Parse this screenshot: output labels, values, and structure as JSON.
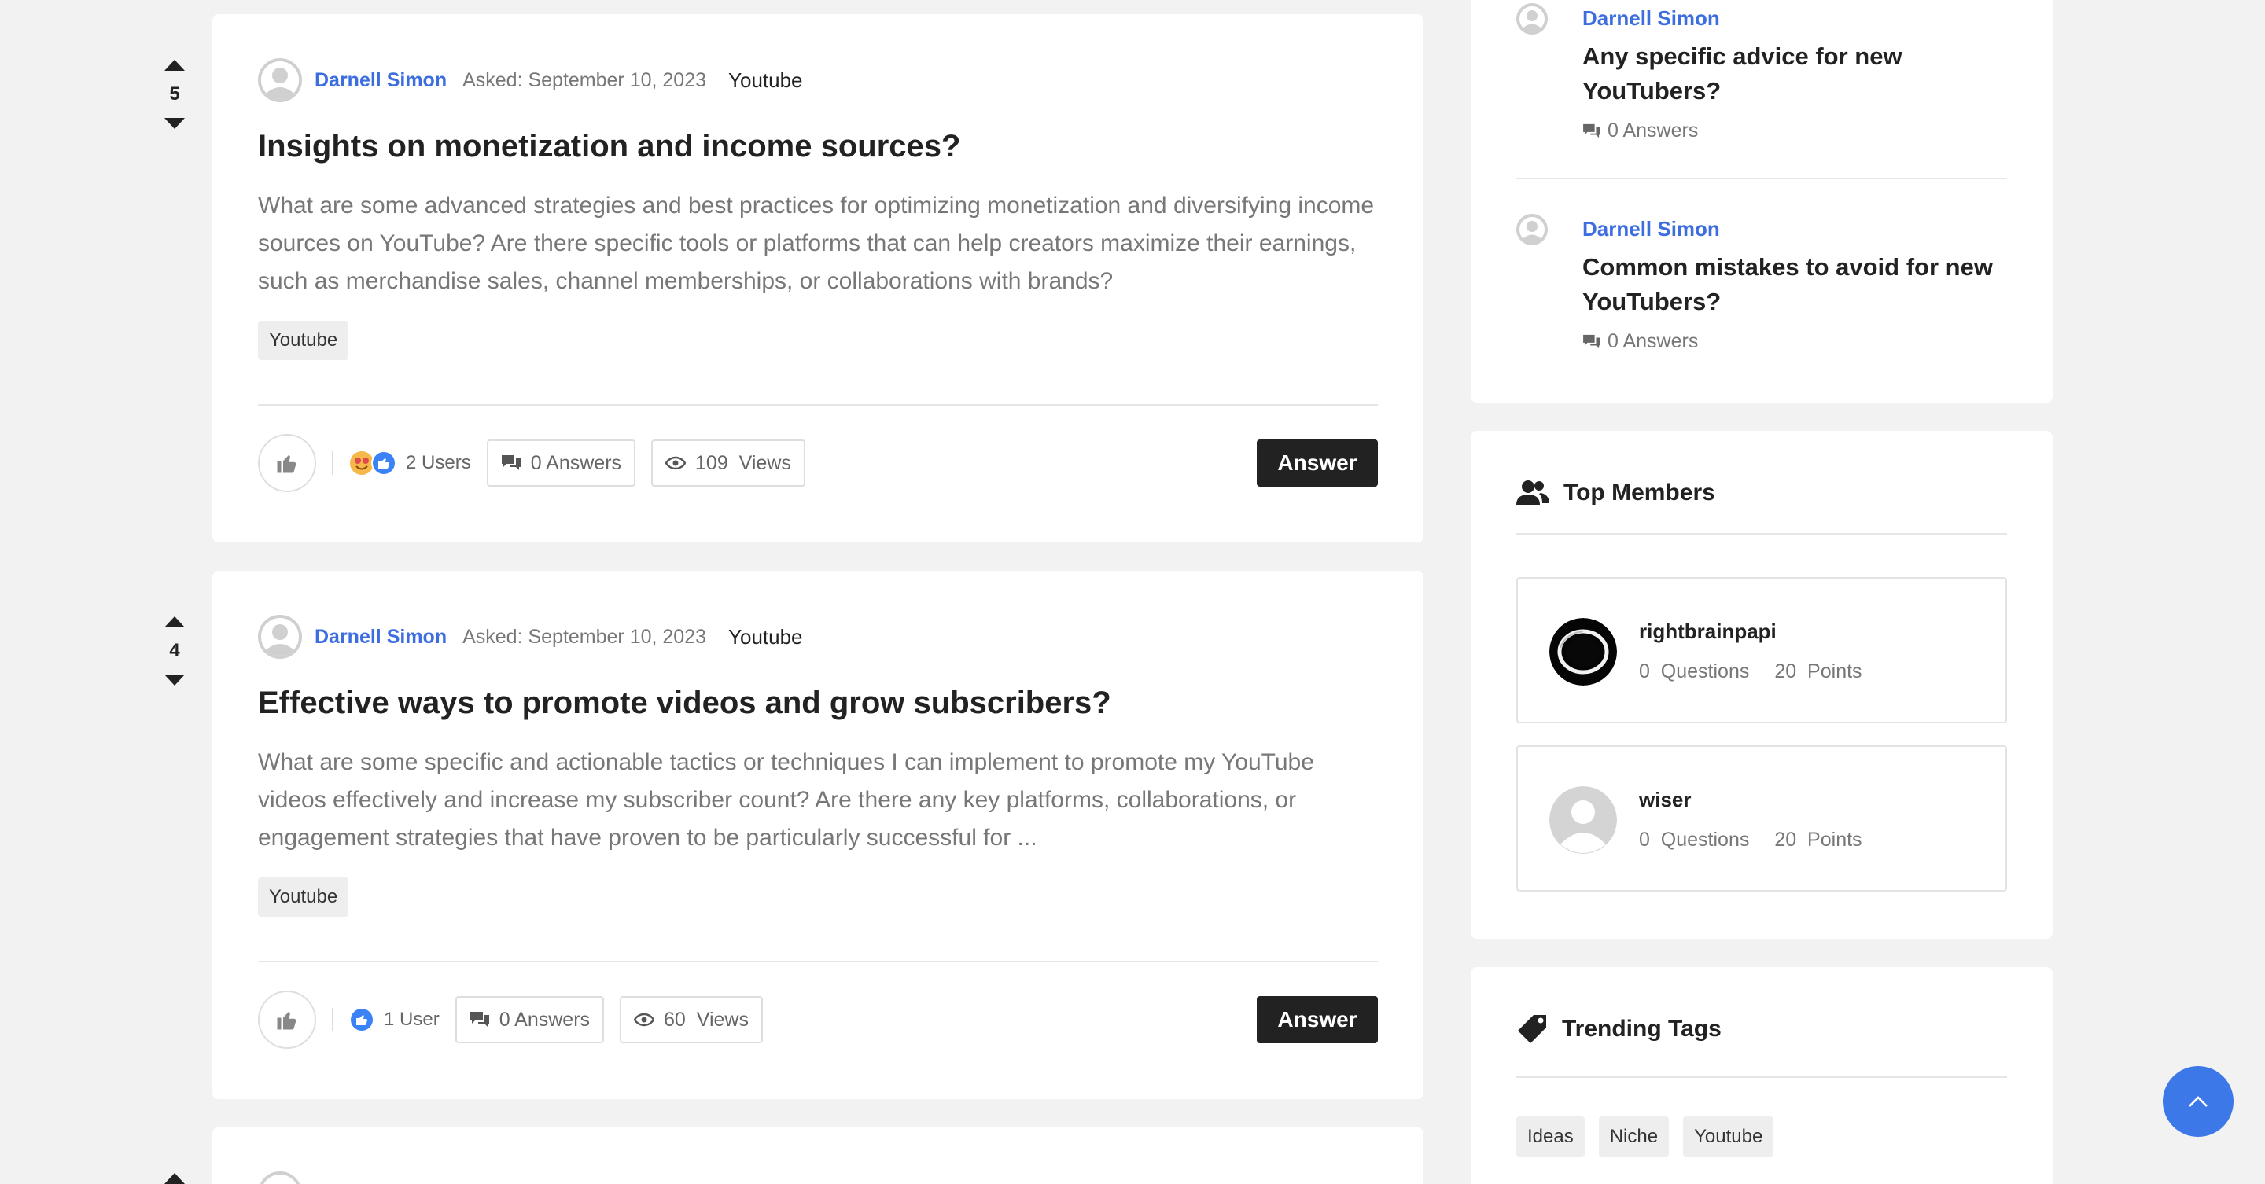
{
  "questions": [
    {
      "votes": "5",
      "author": "Darnell Simon",
      "asked": "Asked: September 10, 2023",
      "category": "Youtube",
      "title": "Insights on monetization and income sources?",
      "excerpt": "What are some advanced strategies and best practices for optimizing monetization and diversifying income sources on YouTube? Are there specific tools or platforms that can help creators maximize their earnings, such as merchandise sales, channel memberships, or collaborations with brands?",
      "tag": "Youtube",
      "reactions": "2 Users",
      "answers": "0 Answers",
      "views": "109  Views",
      "answer_label": "Answer"
    },
    {
      "votes": "4",
      "author": "Darnell Simon",
      "asked": "Asked: September 10, 2023",
      "category": "Youtube",
      "title": "Effective ways to promote videos and grow subscribers?",
      "excerpt": "What are some specific and actionable tactics or techniques I can implement to promote my YouTube videos effectively and increase my subscriber count? Are there any key platforms, collaborations, or engagement strategies that have proven to be particularly successful for ...",
      "tag": "Youtube",
      "reactions": "1 User",
      "answers": "0 Answers",
      "views": "60  Views",
      "answer_label": "Answer"
    }
  ],
  "related": [
    {
      "author": "Darnell Simon",
      "title": "Any specific advice for new YouTubers?",
      "answers": "0 Answers"
    },
    {
      "author": "Darnell Simon",
      "title": "Common mistakes to avoid for new YouTubers?",
      "answers": "0 Answers"
    }
  ],
  "top_members": {
    "heading": "Top Members",
    "members": [
      {
        "name": "rightbrainpapi",
        "questions": "0  Questions",
        "points": "20  Points"
      },
      {
        "name": "wiser",
        "questions": "0  Questions",
        "points": "20  Points"
      }
    ]
  },
  "trending_tags": {
    "heading": "Trending Tags",
    "tags": [
      "Ideas",
      "Niche",
      "Youtube"
    ]
  },
  "colors": {
    "accent": "#3d6ee0",
    "dark_button": "#222222",
    "fab": "#3d78e8"
  }
}
